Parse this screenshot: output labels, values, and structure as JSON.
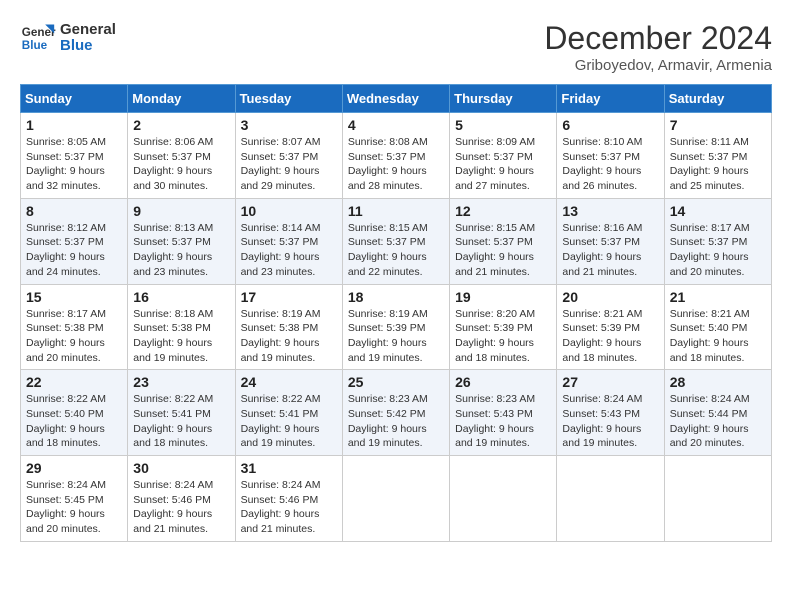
{
  "header": {
    "logo_line1": "General",
    "logo_line2": "Blue",
    "month_title": "December 2024",
    "subtitle": "Griboyedov, Armavir, Armenia"
  },
  "days_of_week": [
    "Sunday",
    "Monday",
    "Tuesday",
    "Wednesday",
    "Thursday",
    "Friday",
    "Saturday"
  ],
  "weeks": [
    [
      {
        "day": "1",
        "sunrise": "8:05 AM",
        "sunset": "5:37 PM",
        "daylight_hours": "9",
        "daylight_minutes": "32"
      },
      {
        "day": "2",
        "sunrise": "8:06 AM",
        "sunset": "5:37 PM",
        "daylight_hours": "9",
        "daylight_minutes": "30"
      },
      {
        "day": "3",
        "sunrise": "8:07 AM",
        "sunset": "5:37 PM",
        "daylight_hours": "9",
        "daylight_minutes": "29"
      },
      {
        "day": "4",
        "sunrise": "8:08 AM",
        "sunset": "5:37 PM",
        "daylight_hours": "9",
        "daylight_minutes": "28"
      },
      {
        "day": "5",
        "sunrise": "8:09 AM",
        "sunset": "5:37 PM",
        "daylight_hours": "9",
        "daylight_minutes": "27"
      },
      {
        "day": "6",
        "sunrise": "8:10 AM",
        "sunset": "5:37 PM",
        "daylight_hours": "9",
        "daylight_minutes": "26"
      },
      {
        "day": "7",
        "sunrise": "8:11 AM",
        "sunset": "5:37 PM",
        "daylight_hours": "9",
        "daylight_minutes": "25"
      }
    ],
    [
      {
        "day": "8",
        "sunrise": "8:12 AM",
        "sunset": "5:37 PM",
        "daylight_hours": "9",
        "daylight_minutes": "24"
      },
      {
        "day": "9",
        "sunrise": "8:13 AM",
        "sunset": "5:37 PM",
        "daylight_hours": "9",
        "daylight_minutes": "23"
      },
      {
        "day": "10",
        "sunrise": "8:14 AM",
        "sunset": "5:37 PM",
        "daylight_hours": "9",
        "daylight_minutes": "23"
      },
      {
        "day": "11",
        "sunrise": "8:15 AM",
        "sunset": "5:37 PM",
        "daylight_hours": "9",
        "daylight_minutes": "22"
      },
      {
        "day": "12",
        "sunrise": "8:15 AM",
        "sunset": "5:37 PM",
        "daylight_hours": "9",
        "daylight_minutes": "21"
      },
      {
        "day": "13",
        "sunrise": "8:16 AM",
        "sunset": "5:37 PM",
        "daylight_hours": "9",
        "daylight_minutes": "21"
      },
      {
        "day": "14",
        "sunrise": "8:17 AM",
        "sunset": "5:37 PM",
        "daylight_hours": "9",
        "daylight_minutes": "20"
      }
    ],
    [
      {
        "day": "15",
        "sunrise": "8:17 AM",
        "sunset": "5:38 PM",
        "daylight_hours": "9",
        "daylight_minutes": "20"
      },
      {
        "day": "16",
        "sunrise": "8:18 AM",
        "sunset": "5:38 PM",
        "daylight_hours": "9",
        "daylight_minutes": "19"
      },
      {
        "day": "17",
        "sunrise": "8:19 AM",
        "sunset": "5:38 PM",
        "daylight_hours": "9",
        "daylight_minutes": "19"
      },
      {
        "day": "18",
        "sunrise": "8:19 AM",
        "sunset": "5:39 PM",
        "daylight_hours": "9",
        "daylight_minutes": "19"
      },
      {
        "day": "19",
        "sunrise": "8:20 AM",
        "sunset": "5:39 PM",
        "daylight_hours": "9",
        "daylight_minutes": "18"
      },
      {
        "day": "20",
        "sunrise": "8:21 AM",
        "sunset": "5:39 PM",
        "daylight_hours": "9",
        "daylight_minutes": "18"
      },
      {
        "day": "21",
        "sunrise": "8:21 AM",
        "sunset": "5:40 PM",
        "daylight_hours": "9",
        "daylight_minutes": "18"
      }
    ],
    [
      {
        "day": "22",
        "sunrise": "8:22 AM",
        "sunset": "5:40 PM",
        "daylight_hours": "9",
        "daylight_minutes": "18"
      },
      {
        "day": "23",
        "sunrise": "8:22 AM",
        "sunset": "5:41 PM",
        "daylight_hours": "9",
        "daylight_minutes": "18"
      },
      {
        "day": "24",
        "sunrise": "8:22 AM",
        "sunset": "5:41 PM",
        "daylight_hours": "9",
        "daylight_minutes": "19"
      },
      {
        "day": "25",
        "sunrise": "8:23 AM",
        "sunset": "5:42 PM",
        "daylight_hours": "9",
        "daylight_minutes": "19"
      },
      {
        "day": "26",
        "sunrise": "8:23 AM",
        "sunset": "5:43 PM",
        "daylight_hours": "9",
        "daylight_minutes": "19"
      },
      {
        "day": "27",
        "sunrise": "8:24 AM",
        "sunset": "5:43 PM",
        "daylight_hours": "9",
        "daylight_minutes": "19"
      },
      {
        "day": "28",
        "sunrise": "8:24 AM",
        "sunset": "5:44 PM",
        "daylight_hours": "9",
        "daylight_minutes": "20"
      }
    ],
    [
      {
        "day": "29",
        "sunrise": "8:24 AM",
        "sunset": "5:45 PM",
        "daylight_hours": "9",
        "daylight_minutes": "20"
      },
      {
        "day": "30",
        "sunrise": "8:24 AM",
        "sunset": "5:46 PM",
        "daylight_hours": "9",
        "daylight_minutes": "21"
      },
      {
        "day": "31",
        "sunrise": "8:24 AM",
        "sunset": "5:46 PM",
        "daylight_hours": "9",
        "daylight_minutes": "21"
      },
      null,
      null,
      null,
      null
    ]
  ],
  "labels": {
    "sunrise": "Sunrise:",
    "sunset": "Sunset:",
    "daylight": "Daylight:",
    "hours_suffix": "hours",
    "and": "and",
    "minutes_suffix": "minutes."
  }
}
